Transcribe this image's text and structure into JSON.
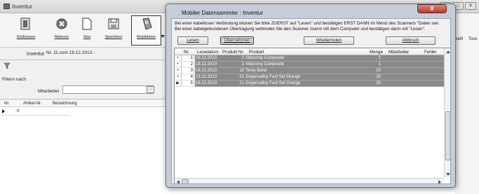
{
  "main_window": {
    "title": "Inventur",
    "window_buttons": [
      "–",
      "□",
      "✕"
    ],
    "toolbar": [
      {
        "label": "Schliessen",
        "icon": "close-document-icon"
      },
      {
        "label": "Abbruch",
        "icon": "cancel-icon"
      },
      {
        "label": "Neu",
        "icon": "new-document-icon"
      },
      {
        "label": "Speichern",
        "icon": "save-icon"
      },
      {
        "label": "Mobildaten",
        "icon": "mobile-scanner-icon"
      }
    ],
    "inventur_label": "Inventur",
    "inventur_value": "Nr. 11 vom 18.12.2013 -",
    "filter_label": "Filtern nach",
    "mitarbeiter_label": "Mitarbeiter",
    "ellipsis_button": "...",
    "grid_headers": [
      "Nr.",
      "Artikel-Nr.",
      "Bezeichnung"
    ],
    "grid_rows": [
      {
        "nr": "0"
      }
    ],
    "right_edge_text": [
      "wahl",
      "Touc"
    ]
  },
  "dialog": {
    "title": "Mobiler Datensammler : Inventur",
    "close_label": "X",
    "info_line1": "Bei einer kabellosen Verbindung klicken Sie bitte ZUERST auf \"Lesen\" und bestätigen ERST DANN im Menü des Scanners \"Daten sen",
    "info_line2": "Bei einer kabelgebundenen Übertragung verbinden Sie den Scanner zuerst mit dem Computer und bestätigen dann mit \"Lesen\".",
    "buttons": {
      "lesen": "Lesen",
      "uebernehmen": "Übernehmen",
      "wiederholen": "Wiederholen",
      "abbruch": "Abbruch"
    },
    "columns": [
      "Nr.",
      "Lesedatum",
      "Produkt Nr.",
      "Produkt",
      "Menge",
      "Mitarbeiter",
      "Fehler"
    ],
    "rows": [
      {
        "indicator": "•",
        "nr": "1",
        "date": "18.12.2013",
        "prod_nr": "2",
        "product": "Alfacomp Composite",
        "menge": "1",
        "mitarbeiter": "",
        "fehler": ""
      },
      {
        "indicator": "•",
        "nr": "2",
        "date": "18.12.2013",
        "prod_nr": "2",
        "product": "Alfacomp Composite",
        "menge": "1",
        "mitarbeiter": "",
        "fehler": ""
      },
      {
        "indicator": "•",
        "nr": "3",
        "date": "18.12.2013",
        "prod_nr": "18",
        "product": "Temp Bond",
        "menge": "20",
        "mitarbeiter": "",
        "fehler": ""
      },
      {
        "indicator": "•",
        "nr": "4",
        "date": "18.12.2013",
        "prod_nr": "21",
        "product": "Dispersalloy Fast Set Orange",
        "menge": "20",
        "mitarbeiter": "",
        "fehler": ""
      },
      {
        "indicator": "▶",
        "nr": "5",
        "date": "18.12.2013",
        "prod_nr": "21",
        "product": "Dispersalloy Fast Set Orange",
        "menge": "20",
        "mitarbeiter": "",
        "fehler": ""
      }
    ],
    "colors": {
      "selected_row": "#8a8a8a",
      "frame": "#c4cdd8",
      "close": "#b33b2c"
    }
  }
}
